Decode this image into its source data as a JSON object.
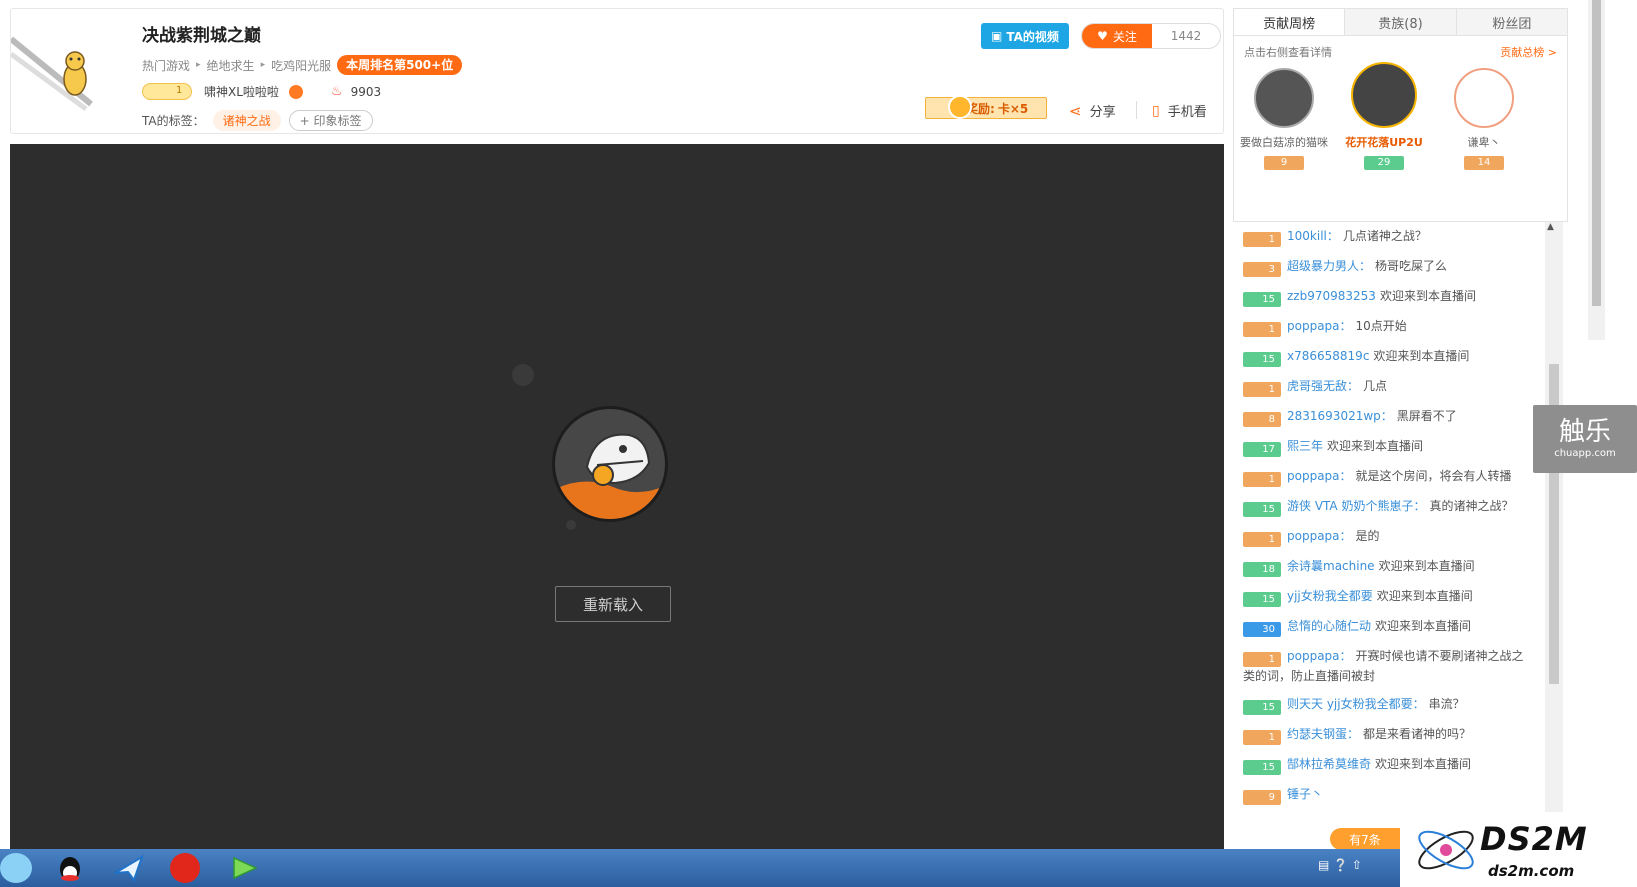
{
  "header": {
    "title": "决战紫荆城之巅",
    "breadcrumbs": [
      "热门游戏",
      "绝地求生",
      "吃鸡阳光服"
    ],
    "rank_badge": "本周排名第500+位",
    "host_level": "1",
    "host_name": "啸神XL啦啦啦",
    "heat_value": "9903",
    "tags_label": "TA的标签：",
    "tag": "诸神之战",
    "tag_add": "+ 印象标签",
    "ta_video": "TA的视频",
    "follow_label": "关注",
    "follow_count": "1442",
    "reward_label": "奖励:",
    "reward_value": "卡×5",
    "share_label": "分享",
    "phone_label": "手机看"
  },
  "player": {
    "reload_label": "重新载入"
  },
  "right_panel": {
    "tabs": [
      "贡献周榜",
      "贵族(8)",
      "粉丝团"
    ],
    "hint": "点击右侧查看详情",
    "more": "贡献总榜 >",
    "top3": [
      {
        "name": "要做白菇凉的猫咪",
        "level": "9",
        "color": "#aaaaaa"
      },
      {
        "name": "花开花落UP2U",
        "level": "29",
        "color": "#f5b400"
      },
      {
        "name": "谦卑丶",
        "level": "14",
        "color": "#f0a080"
      }
    ],
    "chat": [
      {
        "level": "1",
        "kind": "orange",
        "user": "100kill：",
        "text": "几点诸神之战？"
      },
      {
        "level": "3",
        "kind": "orange",
        "user": "超级暴力男人：",
        "text": "杨哥吃屎了么"
      },
      {
        "level": "15",
        "kind": "green",
        "user": "zzb970983253",
        "text": "欢迎来到本直播间"
      },
      {
        "level": "1",
        "kind": "orange",
        "user": "poppapa：",
        "text": "10点开始"
      },
      {
        "level": "15",
        "kind": "green",
        "user": "x786658819c",
        "text": "欢迎来到本直播间"
      },
      {
        "level": "1",
        "kind": "orange",
        "user": "虎哥强无敌：",
        "text": "几点"
      },
      {
        "level": "8",
        "kind": "orange",
        "user": "2831693021wp：",
        "text": "黑屏看不了"
      },
      {
        "level": "17",
        "kind": "green",
        "user": "熙三年",
        "text": "欢迎来到本直播间"
      },
      {
        "level": "1",
        "kind": "orange",
        "user": "poppapa：",
        "text": "就是这个房间，将会有人转播"
      },
      {
        "level": "15",
        "kind": "green",
        "user": "游侠 VTA 奶奶个熊崽子：",
        "text": "真的诸神之战？"
      },
      {
        "level": "1",
        "kind": "orange",
        "user": "poppapa：",
        "text": "是的"
      },
      {
        "level": "18",
        "kind": "green",
        "user": "余诗曩machine",
        "text": "欢迎来到本直播间"
      },
      {
        "level": "15",
        "kind": "green",
        "user": "yjj女粉我全都要",
        "text": "欢迎来到本直播间"
      },
      {
        "level": "30",
        "kind": "blue",
        "user": "怠惰的心随仁动",
        "text": "欢迎来到本直播间"
      },
      {
        "level": "1",
        "kind": "orange",
        "user": "poppapa：",
        "text": "开赛时候也请不要刷诸神之战之类的词，防止直播间被封"
      },
      {
        "level": "15",
        "kind": "green",
        "user": "则天天 yjj女粉我全都要：",
        "text": "串流？"
      },
      {
        "level": "1",
        "kind": "orange",
        "user": "约瑟夫钢蛋：",
        "text": "都是来看诸神的吗？"
      },
      {
        "level": "15",
        "kind": "green",
        "user": "郜林拉希莫维奇",
        "text": "欢迎来到本直播间"
      },
      {
        "level": "9",
        "kind": "orange",
        "user": "锤子丶",
        "text": ""
      }
    ],
    "more_msg": "有7条"
  },
  "watermark": {
    "chuapp_big": "触乐",
    "chuapp_small": "chuapp.com",
    "ds2m_big": "DS2M",
    "ds2m_small": "ds2m.com"
  }
}
